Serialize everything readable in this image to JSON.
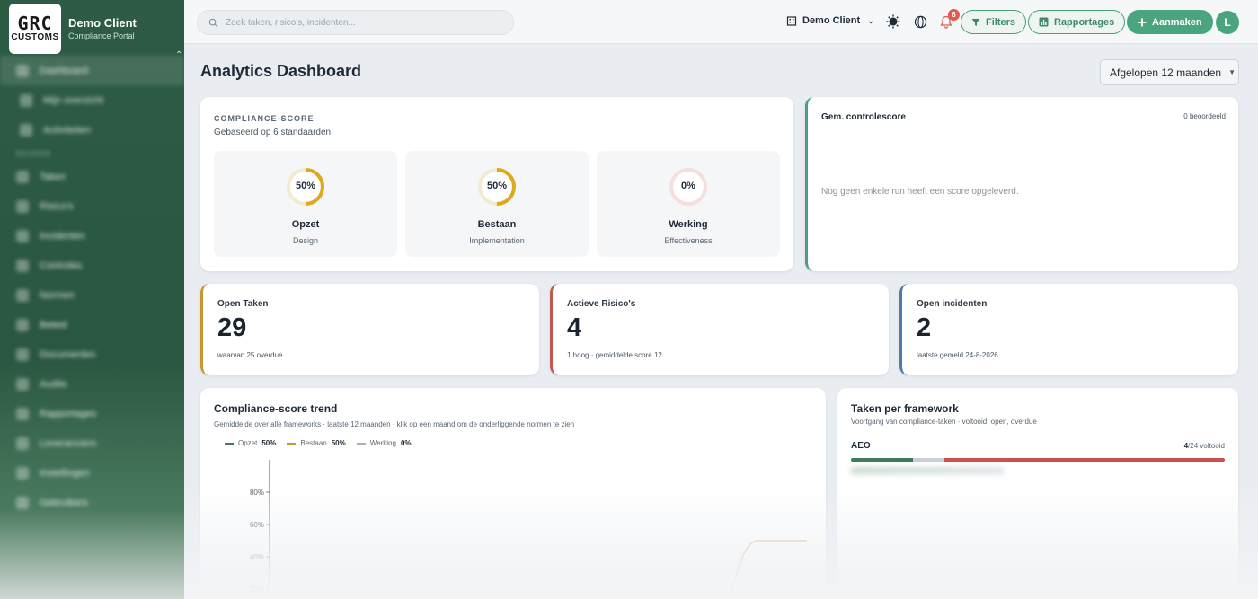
{
  "brand": {
    "logo_top": "GRC",
    "logo_bottom": "CUSTOMS",
    "title": "Demo Client",
    "subtitle": "Compliance Portal"
  },
  "search": {
    "placeholder": "Zoek taken, risico's, incidenten..."
  },
  "topbar": {
    "client": "Demo Client",
    "notifications_count": "6",
    "filters_label": "Filters",
    "reports_label": "Rapportages",
    "create_label": "Aanmaken",
    "avatar_initial": "L"
  },
  "page": {
    "title": "Analytics Dashboard",
    "period": "Afgelopen 12 maanden"
  },
  "compliance": {
    "label": "COMPLIANCE-SCORE",
    "subtitle": "Gebaseerd op 6 standaarden",
    "tiles": [
      {
        "pct_label": "50%",
        "value": 50,
        "name": "Opzet",
        "desc": "Design",
        "color": "#e0a81c"
      },
      {
        "pct_label": "50%",
        "value": 50,
        "name": "Bestaan",
        "desc": "Implementation",
        "color": "#e0a81c"
      },
      {
        "pct_label": "0%",
        "value": 0,
        "name": "Werking",
        "desc": "Effectiveness",
        "color": "#e9a7a7"
      }
    ]
  },
  "control_score": {
    "title": "Gem. controlescore",
    "count": "0 beoordeeld",
    "empty": "Nog geen enkele run heeft een score opgeleverd."
  },
  "kpis": [
    {
      "title": "Open Taken",
      "value": "29",
      "foot": "waarvan 25 overdue",
      "color": "#c99530"
    },
    {
      "title": "Actieve Risico's",
      "value": "4",
      "foot": "1 hoog · gemiddelde score 12",
      "color": "#c0594e"
    },
    {
      "title": "Open incidenten",
      "value": "2",
      "foot": "laatste gemeld 24-8-2026",
      "color": "#4f7ca6"
    }
  ],
  "trend": {
    "title": "Compliance-score trend",
    "subtitle": "Gemiddelde over alle frameworks · laatste 12 maanden · klik op een maand om de onderliggende normen te zien",
    "legend": [
      {
        "name": "Opzet",
        "value": "50%",
        "color": "#3f7a5a"
      },
      {
        "name": "Bestaan",
        "value": "50%",
        "color": "#c99530"
      },
      {
        "name": "Werking",
        "value": "0%",
        "color": "#a9b0b8"
      }
    ]
  },
  "chart_data": {
    "type": "line",
    "title": "Compliance-score trend",
    "y_ticks": [
      "20%",
      "40%",
      "60%",
      "80%"
    ],
    "ylim": [
      0,
      100
    ],
    "x_count": 12,
    "series": [
      {
        "name": "Bestaan",
        "color": "#d9b57a",
        "values": [
          0,
          0,
          0,
          0,
          0,
          0,
          0,
          0,
          0,
          0,
          50,
          50
        ]
      }
    ],
    "grid": false,
    "legend_position": "top-left"
  },
  "frameworks": {
    "title": "Taken per framework",
    "subtitle": "Voortgang van compliance-taken · voltooid, open, overdue",
    "items": [
      {
        "name": "AEO",
        "done": "4",
        "total_label": "/24 voltooid",
        "done_frac": 0.167,
        "open_frac": 0.083,
        "overdue_frac": 0.75
      }
    ]
  },
  "sidebar": {
    "items": [
      {
        "label": "Dashboard",
        "type": "item",
        "active": true
      },
      {
        "label": "Mijn overzicht",
        "type": "sub"
      },
      {
        "label": "Activiteiten",
        "type": "sub"
      },
      {
        "label": "BEHEER",
        "type": "section"
      },
      {
        "label": "Taken",
        "type": "item"
      },
      {
        "label": "Risico's",
        "type": "item"
      },
      {
        "label": "Incidenten",
        "type": "item"
      },
      {
        "label": "Controles",
        "type": "item"
      },
      {
        "label": "Normen",
        "type": "item"
      },
      {
        "label": "Beleid",
        "type": "item"
      },
      {
        "label": "Documenten",
        "type": "item"
      },
      {
        "label": "Audits",
        "type": "item"
      },
      {
        "label": "Rapportages",
        "type": "item"
      },
      {
        "label": "Leveranciers",
        "type": "item"
      },
      {
        "label": "Instellingen",
        "type": "item"
      },
      {
        "label": "Gebruikers",
        "type": "item"
      }
    ]
  }
}
